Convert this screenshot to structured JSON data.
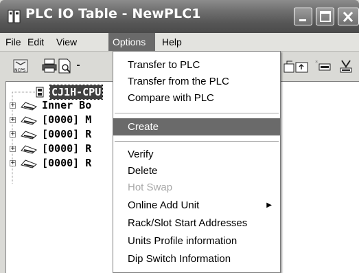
{
  "window": {
    "title": "PLC IO Table - NewPLC1"
  },
  "menubar": {
    "items": [
      {
        "label": "File"
      },
      {
        "label": "Edit"
      },
      {
        "label": "View"
      },
      {
        "label": "Options"
      },
      {
        "label": "Help"
      }
    ],
    "active": "Options"
  },
  "toolbar": {
    "buttons": [
      {
        "icon": "ncps-icon"
      },
      {
        "icon": "print-icon"
      },
      {
        "icon": "print-preview-icon"
      },
      {
        "icon": "transfer-icon"
      },
      {
        "icon": "transfer-from-icon"
      },
      {
        "icon": "unit-delete-icon"
      },
      {
        "icon": "verify-icon"
      }
    ]
  },
  "tree": {
    "items": [
      {
        "label": "CJ1H-CPU",
        "icon": "plc-cpu-icon",
        "selected": true
      },
      {
        "label": "Inner Bo",
        "icon": "rack-icon"
      },
      {
        "label": "[0000] M",
        "icon": "rack-icon"
      },
      {
        "label": "[0000] R",
        "icon": "rack-icon"
      },
      {
        "label": "[0000] R",
        "icon": "rack-icon"
      },
      {
        "label": "[0000] R",
        "icon": "rack-icon"
      }
    ]
  },
  "options_menu": {
    "items": [
      {
        "label": "Transfer to PLC"
      },
      {
        "label": "Transfer from the PLC"
      },
      {
        "label": "Compare with PLC"
      },
      {
        "label": "Create",
        "highlighted": true
      },
      {
        "label": "Verify"
      },
      {
        "label": "Delete"
      },
      {
        "label": "Hot Swap",
        "disabled": true
      },
      {
        "label": "Online Add Unit",
        "submenu": true
      },
      {
        "label": "Rack/Slot Start Addresses"
      },
      {
        "label": "Units Profile information"
      },
      {
        "label": "Dip Switch Information"
      }
    ]
  },
  "colors": {
    "highlight": "#6a6a6a",
    "titlebar": "#5a5a5a"
  }
}
